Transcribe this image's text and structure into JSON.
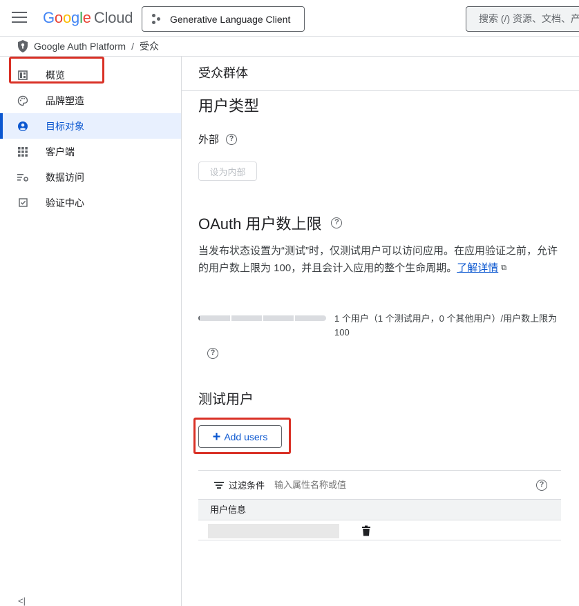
{
  "header": {
    "logo_google": "Google",
    "logo_cloud": "Cloud",
    "project": "Generative Language Client",
    "search_placeholder": "搜索 (/) 资源、文档、产"
  },
  "breadcrumb": {
    "product": "Google Auth Platform",
    "separator": "/",
    "current": "受众"
  },
  "sidebar": {
    "items": [
      {
        "label": "概览",
        "icon": "dashboard-icon"
      },
      {
        "label": "品牌塑造",
        "icon": "palette-icon"
      },
      {
        "label": "目标对象",
        "icon": "account-circle-icon",
        "active": true
      },
      {
        "label": "客户端",
        "icon": "grid-icon"
      },
      {
        "label": "数据访问",
        "icon": "data-settings-icon"
      },
      {
        "label": "验证中心",
        "icon": "checkbox-icon"
      }
    ],
    "collapse_glyph": "<|"
  },
  "main": {
    "title": "受众群体",
    "user_type": {
      "heading": "用户类型",
      "value": "外部",
      "make_internal_button": "设为内部"
    },
    "oauth": {
      "heading": "OAuth 用户数上限",
      "description": "当发布状态设置为“测试”时，仅测试用户可以访问应用。在应用验证之前，允许的用户数上限为 100，并且会计入应用的整个生命周期。",
      "learn_more": "了解详情",
      "progress_fraction": 0.01,
      "progress_text": "1 个用户（1 个测试用户，0 个其他用户）/用户数上限为 100"
    },
    "test_users": {
      "heading": "测试用户",
      "add_button": "Add users",
      "filter_label": "过滤条件",
      "filter_placeholder": "输入属性名称或值",
      "column_header": "用户信息"
    },
    "collapse_label": "收起"
  },
  "colors": {
    "accent": "#0b57d0",
    "highlight": "#d93025",
    "active_bg": "#e8f0fe"
  }
}
